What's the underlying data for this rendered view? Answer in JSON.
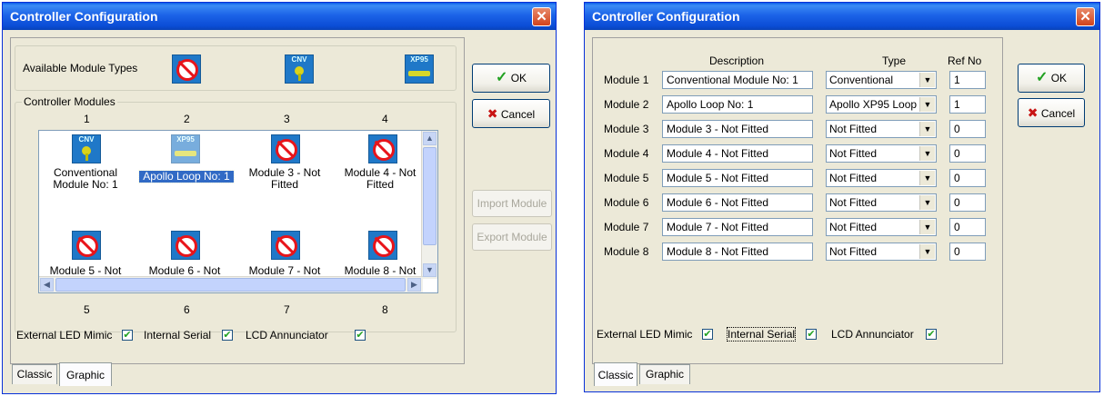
{
  "window1": {
    "title": "Controller Configuration",
    "close_glyph": "✕",
    "available_label": "Available Module Types",
    "module_types": [
      {
        "icon": "not-fitted-icon"
      },
      {
        "icon": "conventional-module-icon",
        "text": "CNV"
      },
      {
        "icon": "apollo-xp95-icon",
        "text": "XP95"
      }
    ],
    "controller_modules_label": "Controller Modules",
    "column_numbers_top": [
      "1",
      "2",
      "3",
      "4"
    ],
    "column_numbers_bottom": [
      "5",
      "6",
      "7",
      "8"
    ],
    "modules": [
      {
        "label": "Conventional Module No: 1",
        "icon": "conventional-module-icon",
        "icon_text": "CNV"
      },
      {
        "label": "Apollo Loop No: 1",
        "icon": "apollo-xp95-icon",
        "icon_text": "XP95",
        "selected": true
      },
      {
        "label": "Module 3 - Not Fitted",
        "icon": "not-fitted-icon"
      },
      {
        "label": "Module 4 - Not Fitted",
        "icon": "not-fitted-icon"
      },
      {
        "label": "Module 5 - Not",
        "icon": "not-fitted-icon"
      },
      {
        "label": "Module 6 - Not",
        "icon": "not-fitted-icon"
      },
      {
        "label": "Module 7 - Not",
        "icon": "not-fitted-icon"
      },
      {
        "label": "Module 8 - Not",
        "icon": "not-fitted-icon"
      }
    ],
    "ok_label": "OK",
    "cancel_label": "Cancel",
    "import_label": "Import Module",
    "export_label": "Export Module",
    "checks": [
      {
        "label": "External LED Mimic",
        "checked": true
      },
      {
        "label": "Internal Serial",
        "checked": true
      },
      {
        "label": "LCD Annunciator",
        "checked": true
      }
    ],
    "tabs": [
      "Classic",
      "Graphic"
    ],
    "active_tab": "Graphic"
  },
  "window2": {
    "title": "Controller Configuration",
    "close_glyph": "✕",
    "headers": {
      "description": "Description",
      "type": "Type",
      "ref": "Ref No"
    },
    "rows": [
      {
        "label": "Module 1",
        "description": "Conventional Module No: 1",
        "type": "Conventional",
        "ref": "1"
      },
      {
        "label": "Module 2",
        "description": "Apollo Loop No: 1",
        "type": "Apollo XP95 Loop",
        "ref": "1"
      },
      {
        "label": "Module 3",
        "description": "Module 3 - Not Fitted",
        "type": "Not Fitted",
        "ref": "0"
      },
      {
        "label": "Module 4",
        "description": "Module 4 - Not Fitted",
        "type": "Not Fitted",
        "ref": "0"
      },
      {
        "label": "Module 5",
        "description": "Module 5 - Not Fitted",
        "type": "Not Fitted",
        "ref": "0"
      },
      {
        "label": "Module 6",
        "description": "Module 6 - Not Fitted",
        "type": "Not Fitted",
        "ref": "0"
      },
      {
        "label": "Module 7",
        "description": "Module 7 - Not Fitted",
        "type": "Not Fitted",
        "ref": "0"
      },
      {
        "label": "Module 8",
        "description": "Module 8 - Not Fitted",
        "type": "Not Fitted",
        "ref": "0"
      }
    ],
    "ok_label": "OK",
    "cancel_label": "Cancel",
    "checks": [
      {
        "label": "External LED Mimic",
        "checked": true
      },
      {
        "label": "Internal Serial",
        "checked": true
      },
      {
        "label": "LCD Annunciator",
        "checked": true
      }
    ],
    "tabs": [
      "Classic",
      "Graphic"
    ],
    "active_tab": "Classic"
  },
  "glyphs": {
    "check": "✔",
    "tick": "✓",
    "cross": "✖",
    "dropdown": "▼",
    "up": "▲",
    "down": "▼",
    "left": "◀",
    "right": "▶"
  },
  "colors": {
    "titlebar": "#0b4dd6",
    "ok_check": "#21a121",
    "cancel_x": "#c81414"
  }
}
